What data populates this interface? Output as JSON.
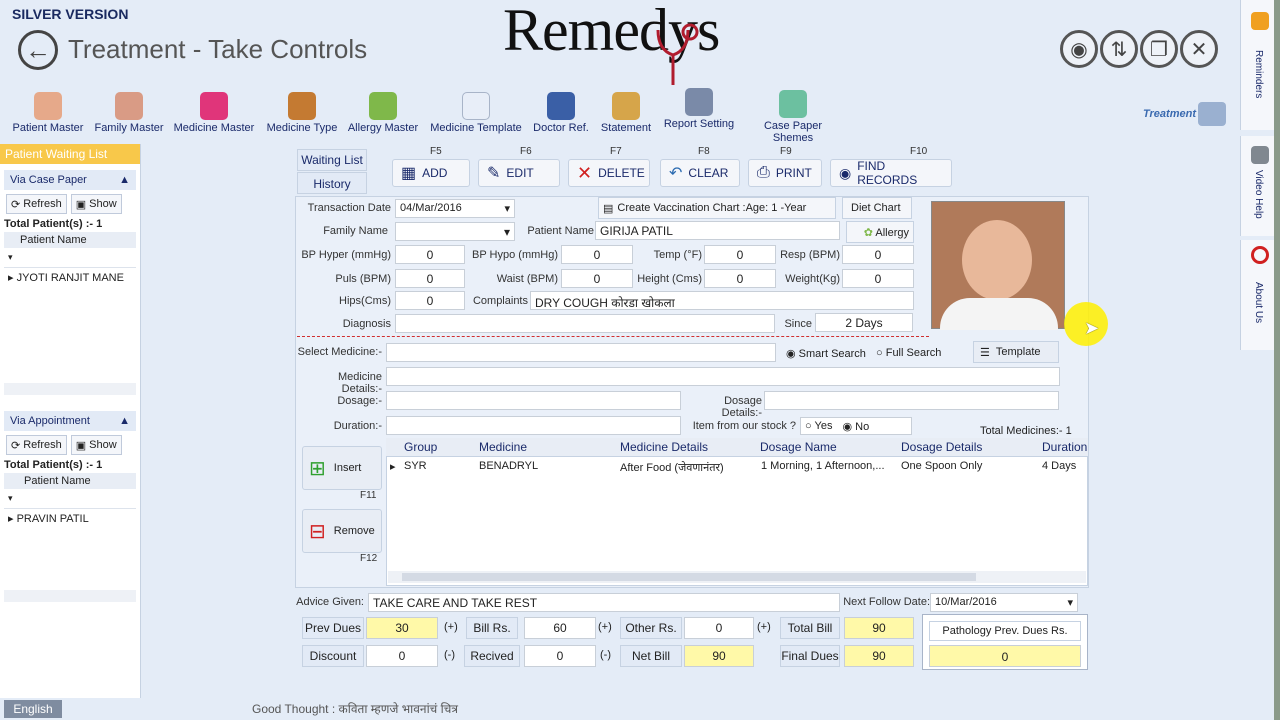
{
  "header": {
    "version": "SILVER VERSION",
    "title": "Treatment - Take Controls",
    "logo": "Remedys"
  },
  "toolbar": {
    "items": [
      "Patient Master",
      "Family Master",
      "Medicine Master",
      "Medicine Type",
      "Allergy Master",
      "Medicine Template",
      "Doctor Ref.",
      "Statement",
      "Report Setting",
      "Case Paper Shemes"
    ],
    "treatment": "Treatment"
  },
  "sidebar": {
    "title": "Patient Waiting List",
    "case_group": "Via Case Paper",
    "refresh": "Refresh",
    "show": "Show",
    "total1": "Total Patient(s) :- 1",
    "col": "Patient Name",
    "patient1": "JYOTI RANJIT MANE",
    "appt_group": "Via Appointment",
    "total2": "Total Patient(s) :- 1",
    "patient2": "PRAVIN PATIL"
  },
  "right_tabs": [
    "Reminders",
    "Video Help",
    "About Us"
  ],
  "tabs": {
    "waiting": "Waiting List",
    "history": "History"
  },
  "actions": [
    {
      "key": "F5",
      "label": "ADD"
    },
    {
      "key": "F6",
      "label": "EDIT"
    },
    {
      "key": "F7",
      "label": "DELETE"
    },
    {
      "key": "F8",
      "label": "CLEAR"
    },
    {
      "key": "F9",
      "label": "PRINT"
    },
    {
      "key": "F10",
      "label": "FIND RECORDS"
    }
  ],
  "form": {
    "transaction_date_label": "Transaction Date",
    "transaction_date": "04/Mar/2016",
    "vaccination": "Create Vaccination Chart :Age: 1 -Year",
    "diet_chart": "Diet Chart",
    "family_name_label": "Family Name",
    "patient_name_label": "Patient Name",
    "patient_name": "GIRIJA PATIL",
    "allergy": "Allergy",
    "bp_hyper_label": "BP Hyper (mmHg)",
    "bp_hyper": "0",
    "bp_hypo_label": "BP Hypo (mmHg)",
    "bp_hypo": "0",
    "temp_label": "Temp (°F)",
    "temp": "0",
    "resp_label": "Resp (BPM)",
    "resp": "0",
    "puls_label": "Puls (BPM)",
    "puls": "0",
    "waist_label": "Waist (BPM)",
    "waist": "0",
    "height_label": "Height (Cms)",
    "height": "0",
    "weight_label": "Weight(Kg)",
    "weight": "0",
    "hips_label": "Hips(Cms)",
    "hips": "0",
    "complaints_label": "Complaints",
    "complaints": "DRY COUGH  कोरडा खोकला",
    "diagnosis_label": "Diagnosis",
    "since_label": "Since",
    "since": "2 Days",
    "select_medicine_label": "Select Medicine:-",
    "smart_search": "Smart Search",
    "full_search": "Full Search",
    "template": "Template",
    "medicine_details_label": "Medicine Details:-",
    "dosage_label": "Dosage:-",
    "dosage_details_label": "Dosage Details:-",
    "duration_label": "Duration:-",
    "stock_label": "Item from our stock ?",
    "yes": "Yes",
    "no": "No",
    "total_medicines": "Total Medicines:- 1",
    "insert": "Insert",
    "insert_key": "F11",
    "remove": "Remove",
    "remove_key": "F12"
  },
  "grid": {
    "headers": [
      "Group",
      "Medicine",
      "Medicine Details",
      "Dosage Name",
      "Dosage Details",
      "Duration"
    ],
    "row": [
      "SYR",
      "BENADRYL",
      "After Food (जेवणानंतर)",
      "1 Morning, 1 Afternoon,...",
      "One Spoon Only",
      "4 Days"
    ]
  },
  "bottom": {
    "advice_label": "Advice Given:",
    "advice": "TAKE CARE AND TAKE REST",
    "follow_label": "Next Follow Date:",
    "follow": "10/Mar/2016",
    "prev_dues_label": "Prev Dues",
    "prev_dues": "30",
    "bill_label": "Bill Rs.",
    "bill": "60",
    "other_label": "Other Rs.",
    "other": "0",
    "total_label": "Total Bill",
    "total": "90",
    "discount_label": "Discount",
    "discount": "0",
    "recived_label": "Recived",
    "recived": "0",
    "net_label": "Net Bill",
    "net": "90",
    "final_label": "Final Dues",
    "final": "90",
    "patho_label": "Pathology Prev. Dues Rs.",
    "patho": "0",
    "plus": "(+)",
    "minus": "(-)"
  },
  "footer": {
    "lang": "English",
    "thought": "Good Thought : कविता म्हणजे भावनांचं चित्र"
  }
}
